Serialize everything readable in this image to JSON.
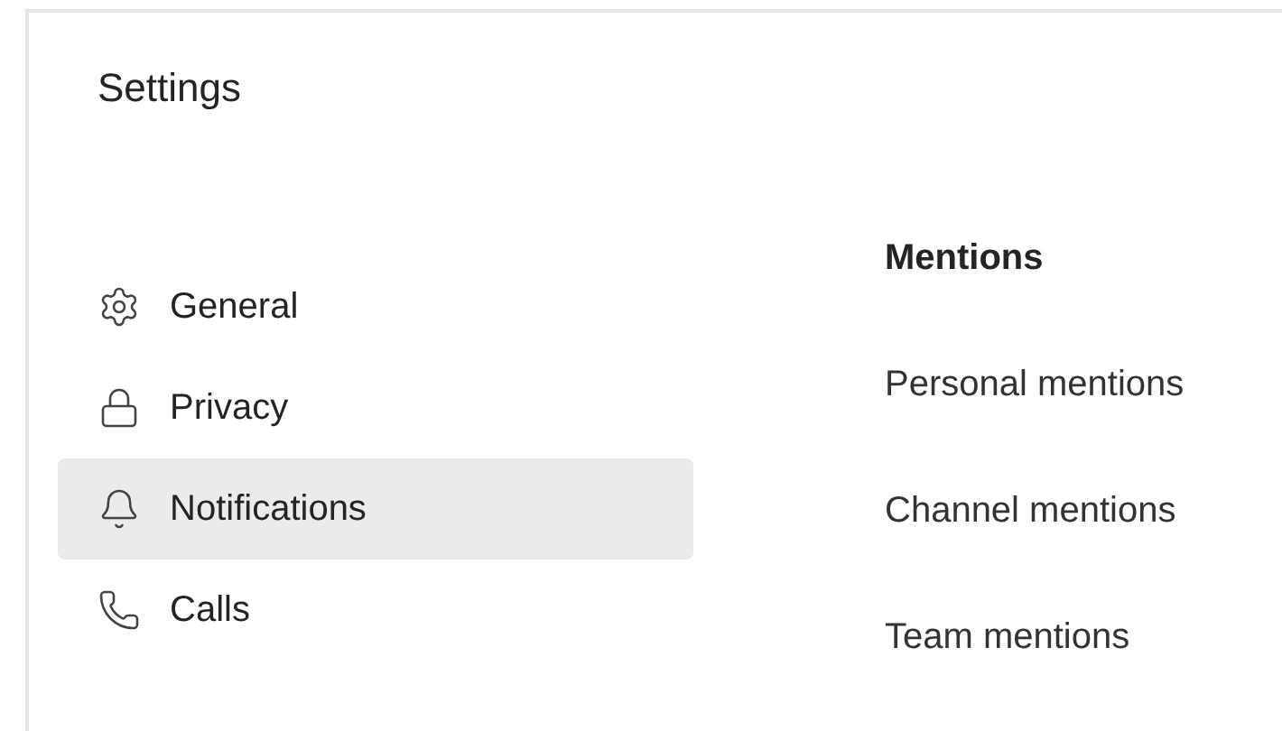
{
  "title": "Settings",
  "sidebar": {
    "items": [
      {
        "label": "General",
        "selected": false
      },
      {
        "label": "Privacy",
        "selected": false
      },
      {
        "label": "Notifications",
        "selected": true
      },
      {
        "label": "Calls",
        "selected": false
      }
    ]
  },
  "section": {
    "heading": "Mentions",
    "rows": [
      "Personal mentions",
      "Channel mentions",
      "Team mentions"
    ]
  }
}
